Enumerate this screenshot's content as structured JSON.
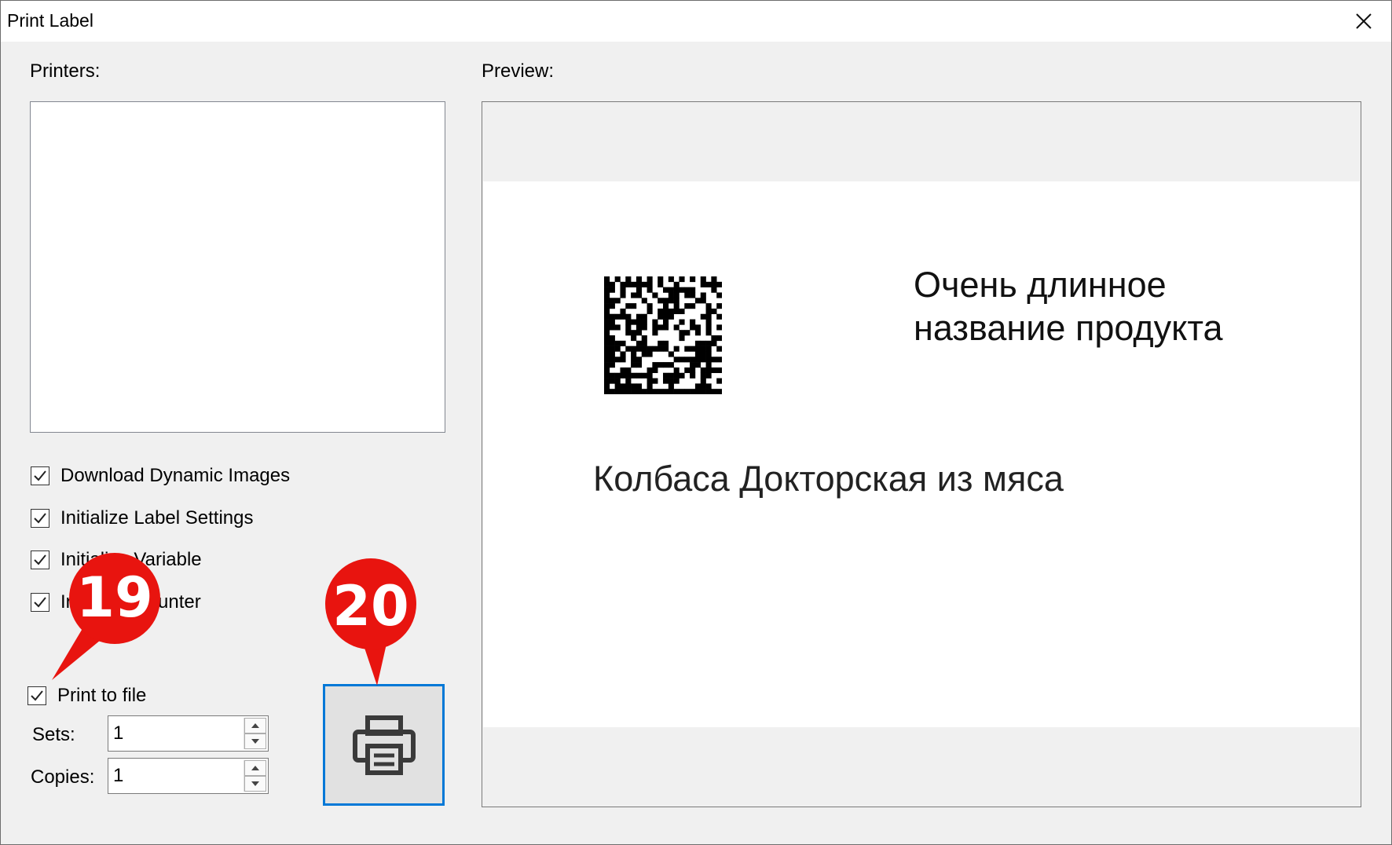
{
  "window": {
    "title": "Print Label"
  },
  "printers": {
    "label": "Printers:"
  },
  "preview": {
    "label": "Preview:",
    "label_title_line1": "Очень длинное",
    "label_title_line2": "название продукта",
    "label_product": "Колбаса Докторская из мяса"
  },
  "options": [
    {
      "label": "Download Dynamic Images",
      "checked": true
    },
    {
      "label": "Initialize Label Settings",
      "checked": true
    },
    {
      "label": "Initialize Variable",
      "checked": true
    },
    {
      "label": "Initialize Counter",
      "checked": true
    }
  ],
  "print_to_file": {
    "label": "Print to file",
    "checked": true
  },
  "sets": {
    "label": "Sets:",
    "value": "1"
  },
  "copies": {
    "label": "Copies:",
    "value": "1"
  },
  "callouts": [
    {
      "number": "19"
    },
    {
      "number": "20"
    }
  ],
  "colors": {
    "callout": "#e8140f",
    "accent": "#0078d7",
    "dialog_bg": "#f0f0f0"
  },
  "icons": {
    "close": "close-icon",
    "print": "printer-icon",
    "check": "checkmark-icon"
  }
}
